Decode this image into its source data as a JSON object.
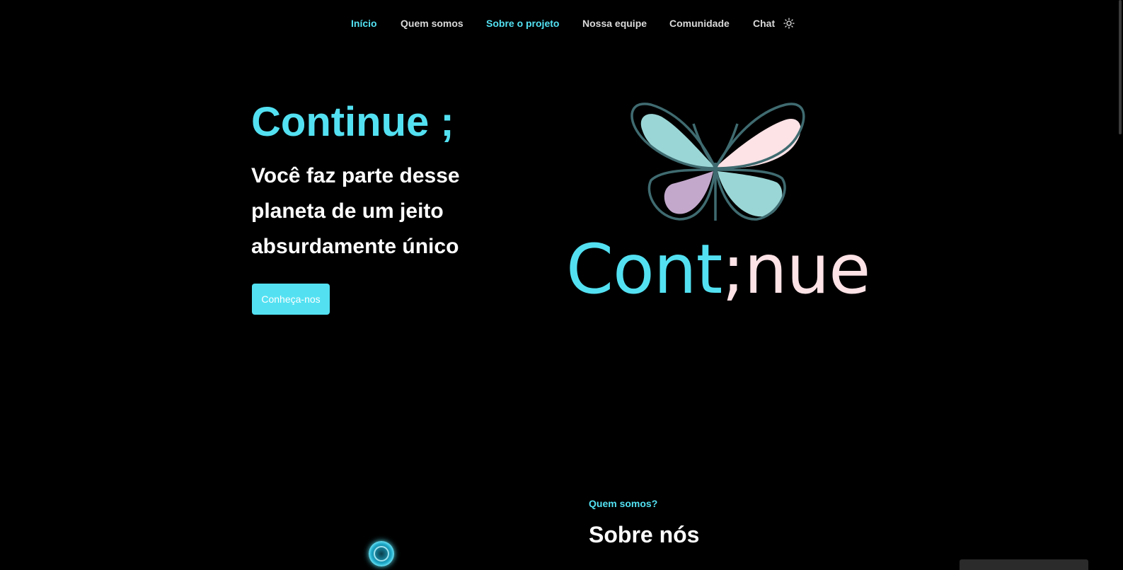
{
  "colors": {
    "background": "#000000",
    "accent": "#53e1f2",
    "text_primary": "#ffffff",
    "nav_text": "#d9d9d9",
    "logo_pink": "#fde2e6"
  },
  "nav": {
    "items": [
      {
        "label": "Início",
        "active": true
      },
      {
        "label": "Quem somos",
        "active": false
      },
      {
        "label": "Sobre o projeto",
        "active": true
      },
      {
        "label": "Nossa equipe",
        "active": false
      },
      {
        "label": "Comunidade",
        "active": false
      },
      {
        "label": "Chat",
        "active": false
      }
    ],
    "theme_toggle_icon": "sun-icon"
  },
  "hero": {
    "title": "Continue ;",
    "subtitle": "Você faz parte desse planeta de um jeito absurdamente único",
    "button_label": "Conheça-nos"
  },
  "logo": {
    "icon": "butterfly-icon",
    "wordmark_part1": "Cont",
    "wordmark_part2": ";nue"
  },
  "about": {
    "kicker": "Quem somos?",
    "title": "Sobre nós"
  }
}
